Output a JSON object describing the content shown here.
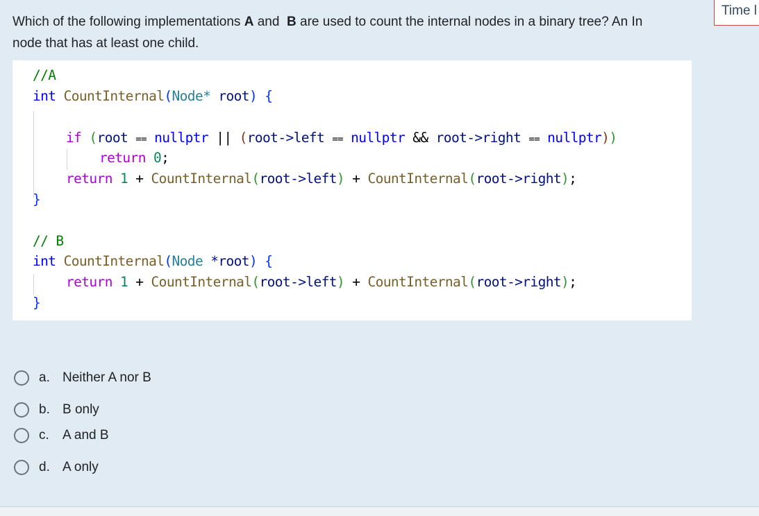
{
  "question": {
    "line1_pre": "Which of the following implementations ",
    "bold_a": "A",
    "line1_mid": " and  ",
    "bold_b": "B",
    "line1_post": " are used to count the internal nodes in a binary tree? An In",
    "line2": "node that has at least one child."
  },
  "timer": {
    "label": "Time l"
  },
  "code": {
    "a": {
      "comment": "//A",
      "sig_type": "int",
      "sig_fn": "CountInternal",
      "sig_param_type": "Node*",
      "sig_param_name": "root",
      "if_kw": "if",
      "cond_root": "root",
      "eq": "==",
      "null": "nullptr",
      "or": "||",
      "root_left": "root->left",
      "and": "&&",
      "root_right": "root->right",
      "return_kw": "return",
      "zero": "0",
      "one": "1",
      "plus": "+",
      "semicolon": ";",
      "close": "}"
    },
    "b": {
      "comment": "// B",
      "sig_type": "int",
      "sig_fn": "CountInternal",
      "sig_param_type": "Node",
      "sig_param_name": "*root",
      "return_kw": "return",
      "one": "1",
      "plus": "+",
      "root_left": "root->left",
      "root_right": "root->right",
      "close": "}"
    }
  },
  "answers": [
    {
      "letter": "a.",
      "text": "Neither A nor B",
      "selected": false
    },
    {
      "letter": "b.",
      "text": "B only",
      "selected": false
    },
    {
      "letter": "c.",
      "text": "A and B",
      "selected": false
    },
    {
      "letter": "d.",
      "text": "A only",
      "selected": false
    }
  ]
}
